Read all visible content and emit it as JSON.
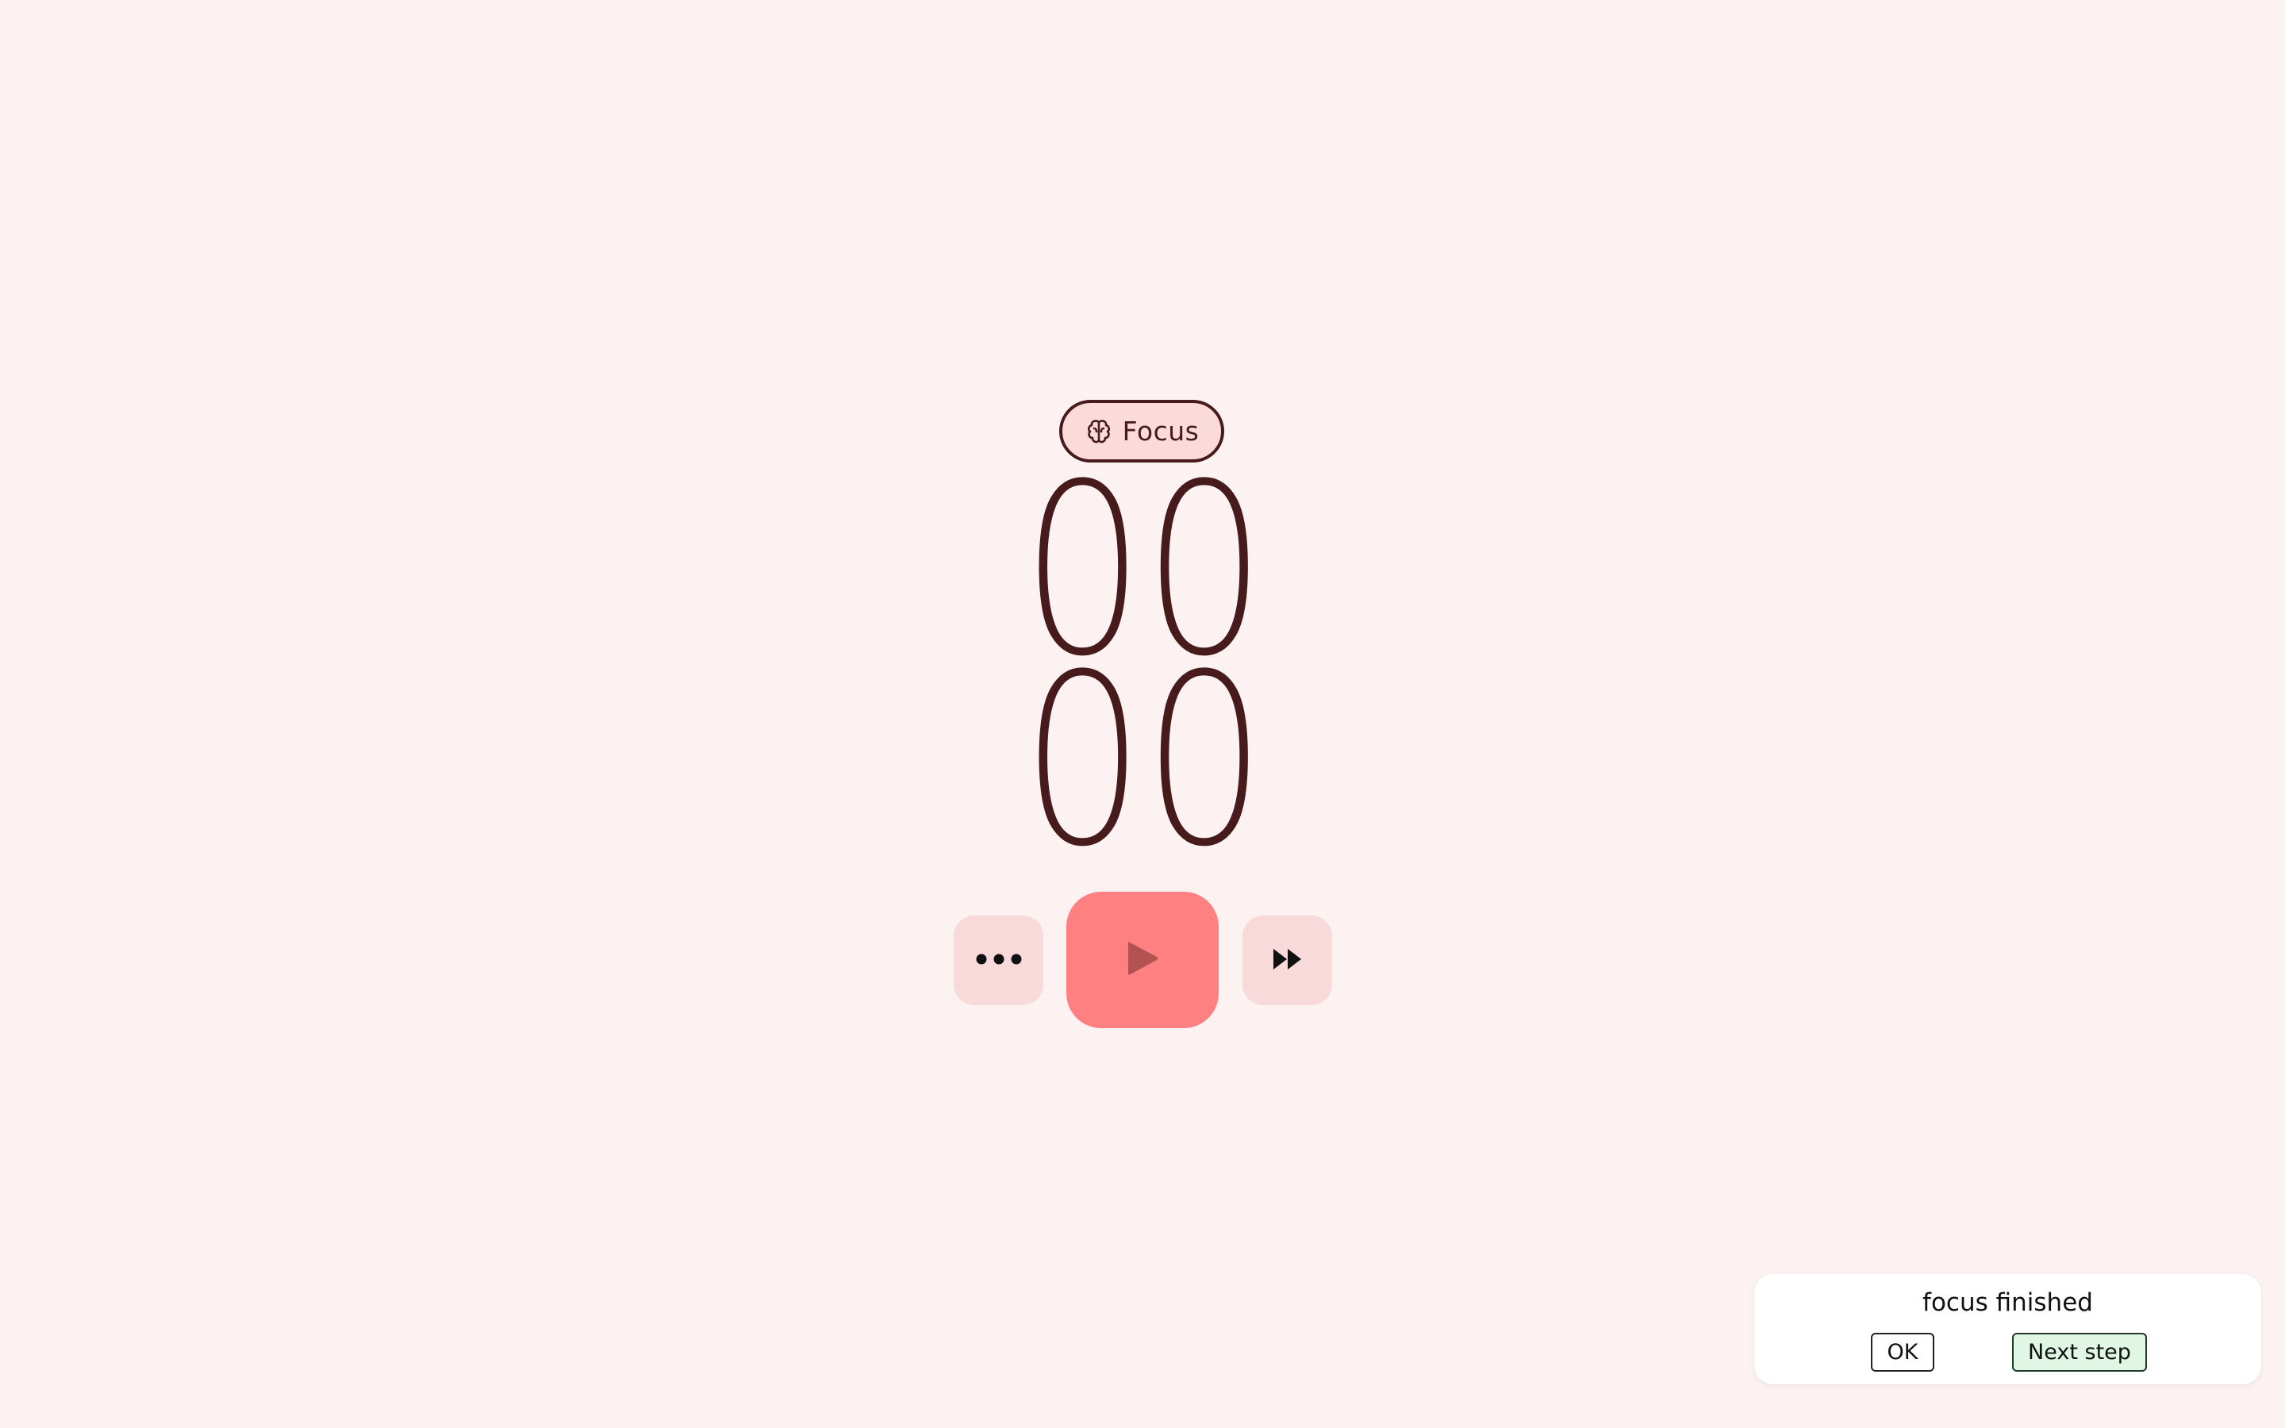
{
  "mode_chip": {
    "label": "Focus",
    "icon": "brain-icon"
  },
  "timer": {
    "minutes": "00",
    "seconds": "00"
  },
  "controls": {
    "more_icon": "more-dots-icon",
    "play_icon": "play-icon",
    "skip_icon": "fast-forward-icon"
  },
  "notification": {
    "message": "focus finished",
    "ok_label": "OK",
    "next_label": "Next step"
  },
  "colors": {
    "background": "#fdf2f2",
    "text": "#471a1c",
    "chip_bg": "#fbdada",
    "secondary_button": "#f8dada",
    "primary_button": "#ff8080",
    "play_icon": "#b35252",
    "next_button_bg": "#dff7e4"
  }
}
